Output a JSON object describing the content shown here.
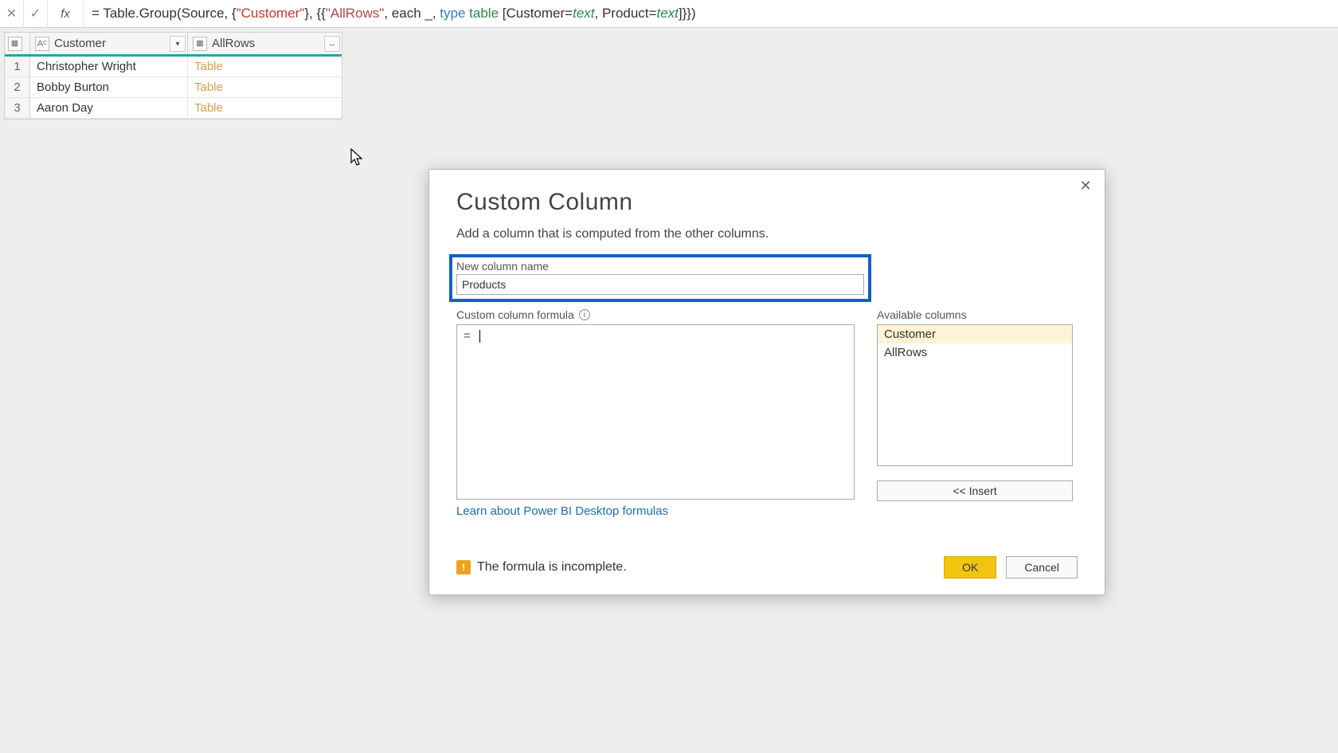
{
  "formula_bar": {
    "fx": "fx",
    "prefix": "= Table.Group(Source, {",
    "arg1": "\"Customer\"",
    "mid1": "}, {{",
    "arg2": "\"AllRows\"",
    "mid2": ", each _, ",
    "kw_type": "type",
    "sp": " ",
    "kw_table": "table",
    "mid3": " [Customer=",
    "t1": "text",
    "mid4": ", Product=",
    "t2": "text",
    "end": "]}})"
  },
  "grid": {
    "columns": {
      "customer": "Customer",
      "allrows": "AllRows"
    },
    "rows": [
      {
        "n": "1",
        "customer": "Christopher Wright",
        "allrows": "Table"
      },
      {
        "n": "2",
        "customer": "Bobby Burton",
        "allrows": "Table"
      },
      {
        "n": "3",
        "customer": "Aaron Day",
        "allrows": "Table"
      }
    ]
  },
  "dialog": {
    "title": "Custom Column",
    "subtitle": "Add a column that is computed from the other columns.",
    "new_col_label": "New column name",
    "new_col_value": "Products",
    "formula_label": "Custom column formula",
    "formula_prefix": "=",
    "avail_label": "Available columns",
    "avail_items": [
      "Customer",
      "AllRows"
    ],
    "insert_label": "<< Insert",
    "learn_link": "Learn about Power BI Desktop formulas",
    "warn_text": "The formula is incomplete.",
    "ok": "OK",
    "cancel": "Cancel"
  }
}
